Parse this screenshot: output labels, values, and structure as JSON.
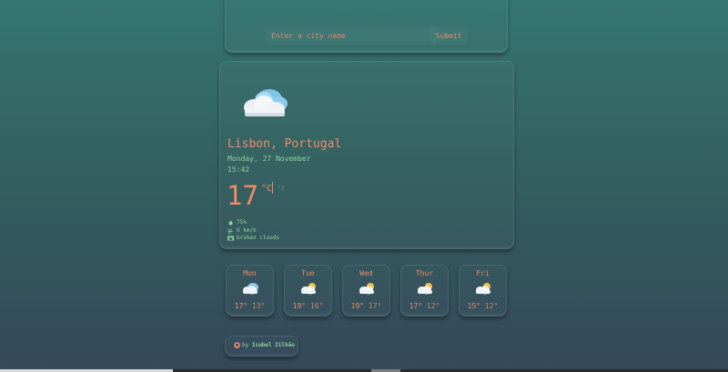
{
  "search": {
    "placeholder": "Enter a city name",
    "submit_label": "Submit"
  },
  "current": {
    "icon": "broken-clouds-icon",
    "location": "Lisbon, Portugal",
    "date": "Monday, 27 November",
    "time": "15:42",
    "temperature": "17",
    "unit_c": "°C",
    "unit_f": "°F",
    "humidity": "75%",
    "wind": "0 km/h",
    "description": "broken clouds"
  },
  "forecast": [
    {
      "day": "Mon",
      "max": "17°",
      "min": "13°",
      "icon": "cloud-icon"
    },
    {
      "day": "Tue",
      "max": "19°",
      "min": "16°",
      "icon": "partly-cloudy-icon"
    },
    {
      "day": "Wed",
      "max": "19°",
      "min": "17°",
      "icon": "partly-cloudy-icon"
    },
    {
      "day": "Thur",
      "max": "17°",
      "min": "12°",
      "icon": "partly-cloudy-icon"
    },
    {
      "day": "Fri",
      "max": "15°",
      "min": "12°",
      "icon": "partly-cloudy-icon"
    }
  ],
  "footer": {
    "by": "by",
    "author": "Isabel Zilhão",
    "icon": "github-icon"
  },
  "colors": {
    "accent": "#f08a68",
    "secondary": "#8fd29a"
  }
}
